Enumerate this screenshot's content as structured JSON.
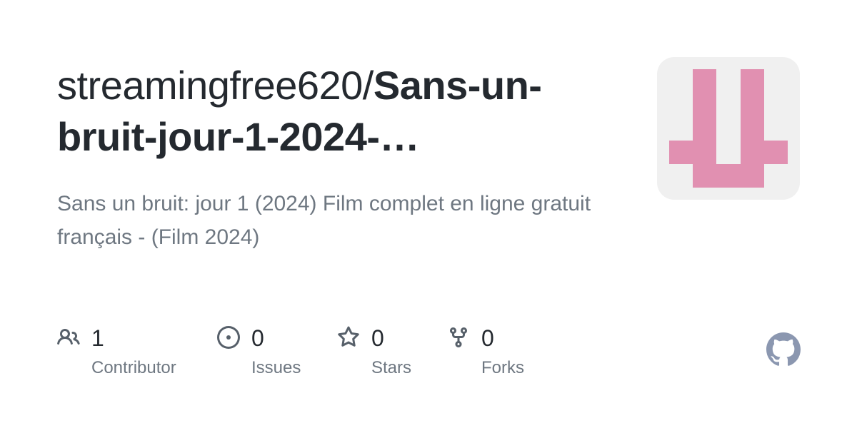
{
  "repo": {
    "owner": "streamingfree620/",
    "name": "Sans-un-bruit-jour-1-2024-…",
    "description": "Sans un bruit: jour 1 (2024) Film complet en ligne gratuit français - (Film 2024)"
  },
  "stats": [
    {
      "icon": "people-icon",
      "count": "1",
      "label": "Contributor"
    },
    {
      "icon": "issue-opened-icon",
      "count": "0",
      "label": "Issues"
    },
    {
      "icon": "star-icon",
      "count": "0",
      "label": "Stars"
    },
    {
      "icon": "repo-forked-icon",
      "count": "0",
      "label": "Forks"
    }
  ],
  "colors": {
    "title": "#24292f",
    "muted": "#6e7781",
    "icon": "#57606a",
    "avatar_bg": "#f0f0f0",
    "avatar_fg": "#e190b1",
    "github_mark": "#8b97b0"
  },
  "avatar_icon": "identicon",
  "footer_icon": "github-mark-icon"
}
